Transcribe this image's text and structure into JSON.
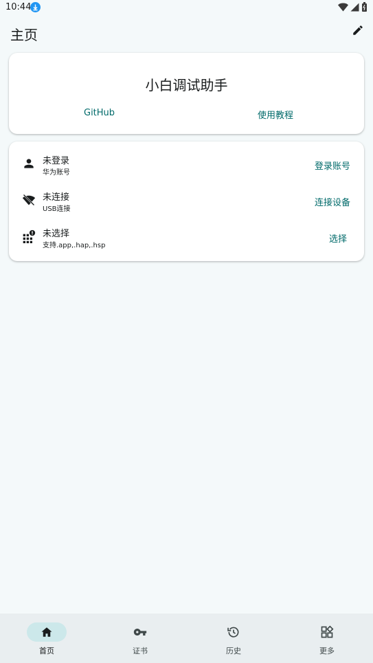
{
  "status_bar": {
    "time": "10:44",
    "notification_icon": "download-badge-icon",
    "icons": [
      "wifi-icon",
      "signal-icon",
      "battery-icon"
    ]
  },
  "app_bar": {
    "title": "主页",
    "action_icon": "edit-icon"
  },
  "title_card": {
    "title": "小白调试助手",
    "links": {
      "github": "GitHub",
      "tutorial": "使用教程"
    }
  },
  "status_card": {
    "rows": [
      {
        "icon": "person-icon",
        "title": "未登录",
        "subtitle": "华为账号",
        "action": "登录账号"
      },
      {
        "icon": "wifi-off-icon",
        "title": "未连接",
        "subtitle": "USB连接",
        "action": "连接设备"
      },
      {
        "icon": "apps-alert-icon",
        "title": "未选择",
        "subtitle": "支持.app,.hap,.hsp",
        "action": "选择"
      }
    ]
  },
  "bottom_nav": {
    "items": [
      {
        "label": "首页",
        "icon": "home-icon",
        "selected": true
      },
      {
        "label": "证书",
        "icon": "key-icon",
        "selected": false
      },
      {
        "label": "历史",
        "icon": "history-icon",
        "selected": false
      },
      {
        "label": "更多",
        "icon": "widgets-icon",
        "selected": false
      }
    ]
  },
  "colors": {
    "background": "#f4f9fa",
    "accent": "#006a6a",
    "nav_indicator": "#cce8ea",
    "nav_background": "#e9eef0"
  }
}
